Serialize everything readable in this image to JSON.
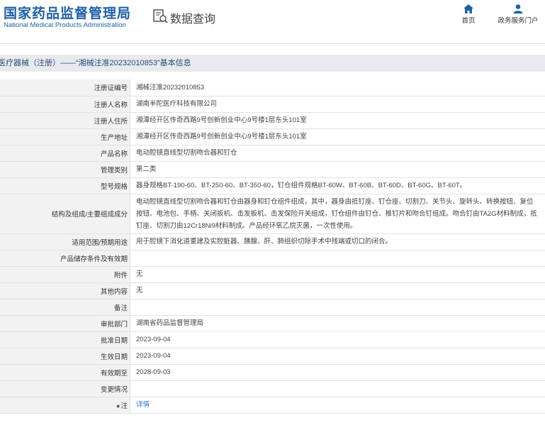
{
  "header": {
    "logo_cn": "国家药品监督管理局",
    "logo_en": "National Medical Products Administration",
    "query_title": "数据查询",
    "nav": [
      {
        "label": "首页",
        "icon": "home-icon"
      },
      {
        "label": "政务服务门户",
        "icon": "user-icon"
      }
    ]
  },
  "breadcrumb": "医疗器械（注册）——“湘械注准20232010853”基本信息",
  "rows": [
    {
      "label": "注册证编号",
      "value": "湘械注准20232010853"
    },
    {
      "label": "注册人名称",
      "value": "湖南半陀医疗科技有限公司"
    },
    {
      "label": "注册人住所",
      "value": "湘潭经开区传奇西路9号创新创业中心9号楼1层东头101室"
    },
    {
      "label": "生产地址",
      "value": "湘潭经开区传奇西路9号创新创业中心9号楼1层东头101室"
    },
    {
      "label": "产品名称",
      "value": "电动腔镜直线型切割吻合器和钉仓"
    },
    {
      "label": "管理类别",
      "value": "第二类"
    },
    {
      "label": "型号规格",
      "value": "器身规格BT-190-60、BT-250-60、BT-350-60，钉仓组件规格BT-60W、BT-60B、BT-60D、BT-60G、BT-60T。"
    },
    {
      "label": "结构及组成/主要组成成分",
      "value": "电动腔镜直线型切割吻合器和钉仓由器身和钉仓组件组成，其中，器身由抵钉座、钉仓座、切割刀、关节头、旋转头、转换按钮、复位按钮、电池包、手柄、关闭扳机、击发扳机、击发保险开关组成，钉仓组件由钉仓、推钉片和吻合钉组成。吻合钉由TA2G材料制成，抵钉座、切割刀由12Cr18Ni9材料制成。产品经环氧乙烷灭菌，一次性使用。"
    },
    {
      "label": "适用范围/预期用途",
      "value": "用于腔镜下消化道重建及实腔脏器、胰腺、肝、肺组织切除手术中残端或切口的闭合。"
    },
    {
      "label": "产品储存条件及有效期",
      "value": ""
    },
    {
      "label": "附件",
      "value": "无"
    },
    {
      "label": "其他内容",
      "value": "无"
    },
    {
      "label": "备注",
      "value": ""
    },
    {
      "label": "审批部门",
      "value": "湖南省药品监督管理局"
    },
    {
      "label": "批准日期",
      "value": "2023-09-04"
    },
    {
      "label": "生效日期",
      "value": "2023-09-04"
    },
    {
      "label": "有效期至",
      "value": "2028-09-03"
    },
    {
      "label": "变更情况",
      "value": ""
    }
  ],
  "note": {
    "label": "注",
    "link": "详情"
  }
}
